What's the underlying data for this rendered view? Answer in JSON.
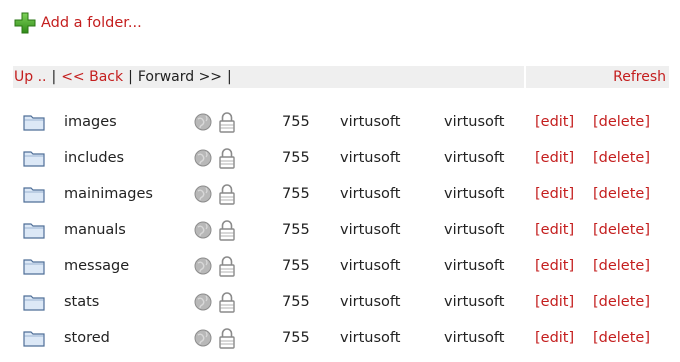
{
  "toolbar": {
    "add_folder_label": "Add a folder..."
  },
  "nav": {
    "up_label": "Up ..",
    "back_label": "<< Back",
    "forward_label": "Forward >>",
    "separator": "|",
    "refresh_label": "Refresh"
  },
  "folders": [
    {
      "name": "images",
      "perm": "755",
      "owner": "virtusoft",
      "group": "virtusoft",
      "edit": "[edit]",
      "delete": "[delete]"
    },
    {
      "name": "includes",
      "perm": "755",
      "owner": "virtusoft",
      "group": "virtusoft",
      "edit": "[edit]",
      "delete": "[delete]"
    },
    {
      "name": "mainimages",
      "perm": "755",
      "owner": "virtusoft",
      "group": "virtusoft",
      "edit": "[edit]",
      "delete": "[delete]"
    },
    {
      "name": "manuals",
      "perm": "755",
      "owner": "virtusoft",
      "group": "virtusoft",
      "edit": "[edit]",
      "delete": "[delete]"
    },
    {
      "name": "message",
      "perm": "755",
      "owner": "virtusoft",
      "group": "virtusoft",
      "edit": "[edit]",
      "delete": "[delete]"
    },
    {
      "name": "stats",
      "perm": "755",
      "owner": "virtusoft",
      "group": "virtusoft",
      "edit": "[edit]",
      "delete": "[delete]"
    },
    {
      "name": "stored",
      "perm": "755",
      "owner": "virtusoft",
      "group": "virtusoft",
      "edit": "[edit]",
      "delete": "[delete]"
    }
  ],
  "icons": {
    "add": "plus-icon",
    "folder": "folder-icon",
    "public": "globe-icon",
    "locked": "lock-icon"
  },
  "colors": {
    "link": "#c41e1e",
    "plus": "#3a9a1c",
    "nav_background": "#efefef",
    "text": "#222222"
  }
}
